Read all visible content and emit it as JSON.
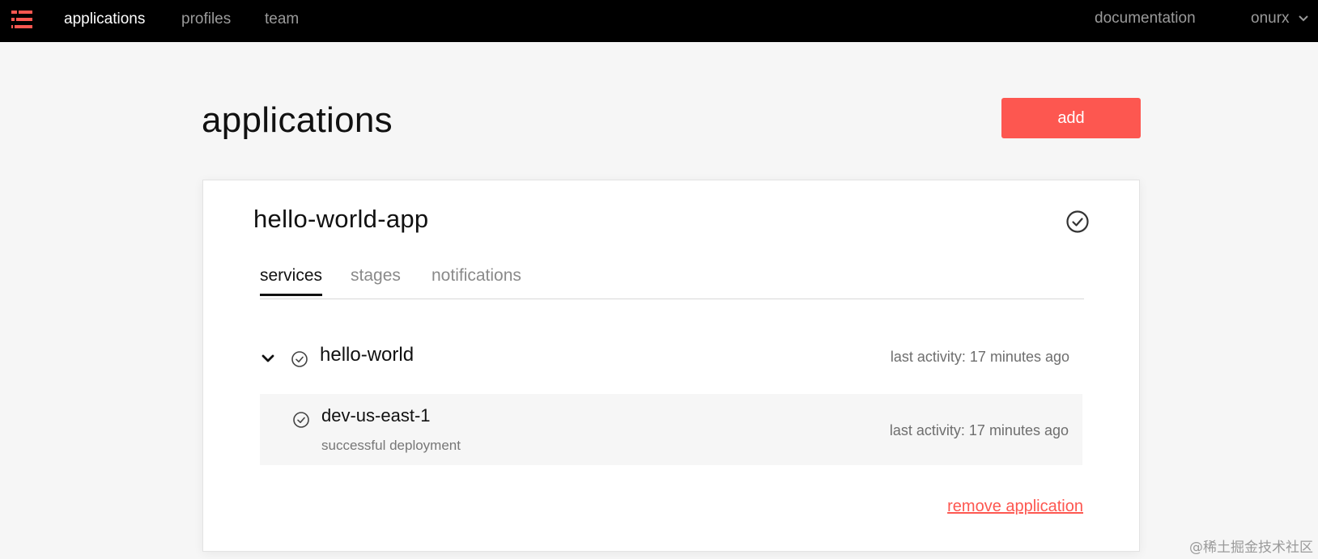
{
  "nav": {
    "logo_icon": "serverless-logo-icon",
    "brand_color": "#fd5750",
    "links": {
      "applications": "applications",
      "profiles": "profiles",
      "team": "team"
    },
    "documentation": "documentation",
    "user": "onurx"
  },
  "page": {
    "title": "applications",
    "add_label": "add",
    "accent_color": "#fd5750"
  },
  "app": {
    "name": "hello-world-app",
    "status_icon": "check-circle-icon",
    "tabs": {
      "services": "services",
      "stages": "stages",
      "notifications": "notifications"
    },
    "active_tab": "services",
    "service": {
      "name": "hello-world",
      "last_activity": "last activity: 17 minutes ago",
      "expanded": true,
      "stage": {
        "name": "dev-us-east-1",
        "message": "successful deployment",
        "last_activity": "last activity: 17 minutes ago"
      }
    },
    "remove_label": "remove application"
  },
  "watermark": "@稀土掘金技术社区"
}
